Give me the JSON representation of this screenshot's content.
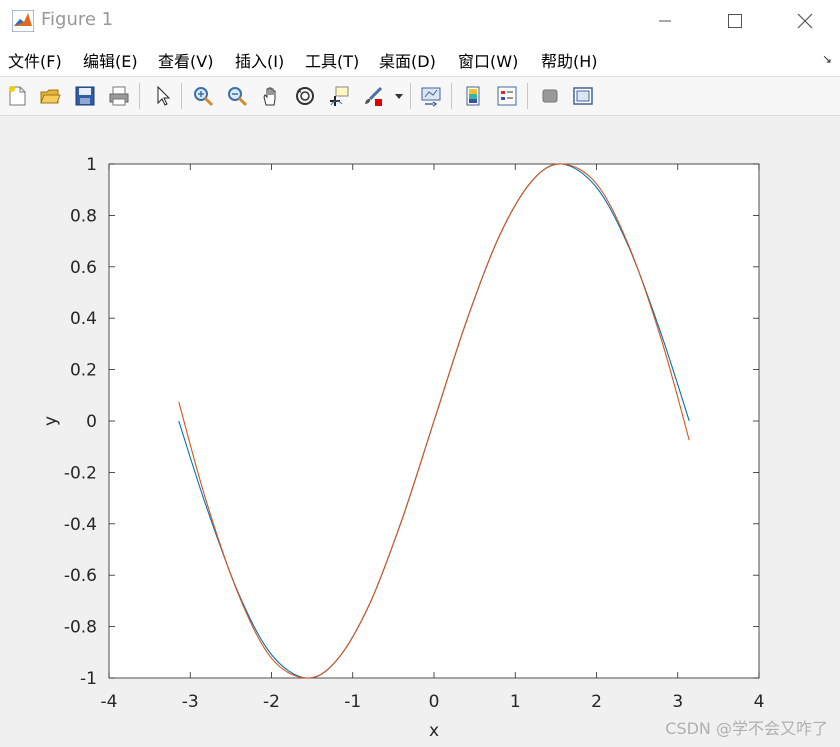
{
  "window": {
    "title": "Figure 1"
  },
  "menu": [
    {
      "label": "文件(F)"
    },
    {
      "label": "编辑(E)"
    },
    {
      "label": "查看(V)"
    },
    {
      "label": "插入(I)"
    },
    {
      "label": "工具(T)"
    },
    {
      "label": "桌面(D)"
    },
    {
      "label": "窗口(W)"
    },
    {
      "label": "帮助(H)"
    }
  ],
  "menu_overflow": "↘",
  "toolbar_icons": [
    "new-figure-icon",
    "open-folder-icon",
    "save-icon",
    "print-icon",
    "pointer-icon",
    "zoom-in-icon",
    "zoom-out-icon",
    "pan-hand-icon",
    "rotate-3d-icon",
    "data-cursor-icon",
    "brush-icon",
    "dropdown-arrow-icon",
    "link-plot-icon",
    "colorbar-icon",
    "legend-icon",
    "hide-plot-tools-icon",
    "show-plot-tools-icon"
  ],
  "colors": {
    "series1": "#0072BD",
    "series2": "#D95319",
    "axes": "#262626"
  },
  "chart_data": {
    "type": "line",
    "title": "",
    "xlabel": "x",
    "ylabel": "y",
    "xlim": [
      -4,
      4
    ],
    "ylim": [
      -1,
      1
    ],
    "xticks": [
      -4,
      -3,
      -2,
      -1,
      0,
      1,
      2,
      3,
      4
    ],
    "xtick_labels": [
      "-4",
      "-3",
      "-2",
      "-1",
      "0",
      "1",
      "2",
      "3",
      "4"
    ],
    "yticks": [
      -1,
      -0.8,
      -0.6,
      -0.4,
      -0.2,
      0,
      0.2,
      0.4,
      0.6,
      0.8,
      1
    ],
    "ytick_labels": [
      "-1",
      "-0.8",
      "-0.6",
      "-0.4",
      "-0.2",
      "0",
      "0.2",
      "0.4",
      "0.6",
      "0.8",
      "1"
    ],
    "grid": false,
    "series": [
      {
        "color": "#0072BD",
        "x": [
          -3.1416,
          -2.8,
          -2.4,
          -2.0,
          -1.5708,
          -1.2,
          -0.8,
          -0.4,
          0,
          0.4,
          0.8,
          1.2,
          1.5708,
          2.0,
          2.4,
          2.8,
          3.1416
        ],
        "y": [
          0,
          -0.335,
          -0.675,
          -0.909,
          -1,
          -0.932,
          -0.717,
          -0.389,
          0,
          0.389,
          0.717,
          0.932,
          1,
          0.909,
          0.675,
          0.335,
          0
        ]
      },
      {
        "color": "#D95319",
        "x": [
          -3.1416,
          -2.8,
          -2.4,
          -2.0,
          -1.5708,
          -1.2,
          -0.8,
          -0.4,
          0,
          0.4,
          0.8,
          1.2,
          1.5708,
          2.0,
          2.4,
          2.8,
          3.1416
        ],
        "y": [
          0.075,
          -0.315,
          -0.68,
          -0.923,
          -1,
          -0.932,
          -0.717,
          -0.389,
          0,
          0.389,
          0.717,
          0.932,
          1,
          0.923,
          0.68,
          0.315,
          -0.075
        ]
      }
    ]
  },
  "watermark": "CSDN @学不会又咋了"
}
